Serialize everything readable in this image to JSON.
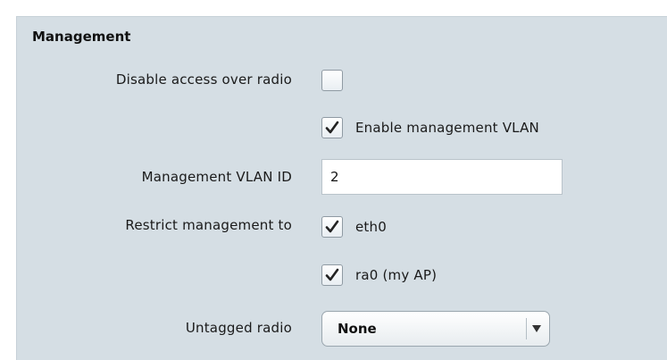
{
  "section": {
    "title": "Management"
  },
  "fields": {
    "disable_radio": {
      "label": "Disable access over radio",
      "checked": false
    },
    "enable_vlan": {
      "label": "Enable management VLAN",
      "checked": true
    },
    "vlan_id": {
      "label": "Management VLAN ID",
      "value": "2"
    },
    "restrict": {
      "label": "Restrict management to",
      "options": [
        {
          "label": "eth0",
          "checked": true
        },
        {
          "label": "ra0 (my AP)",
          "checked": true
        }
      ]
    },
    "untagged_radio": {
      "label": "Untagged radio",
      "selected": "None"
    }
  },
  "colors": {
    "panel_bg": "#d5dee4",
    "check": "#222222"
  }
}
